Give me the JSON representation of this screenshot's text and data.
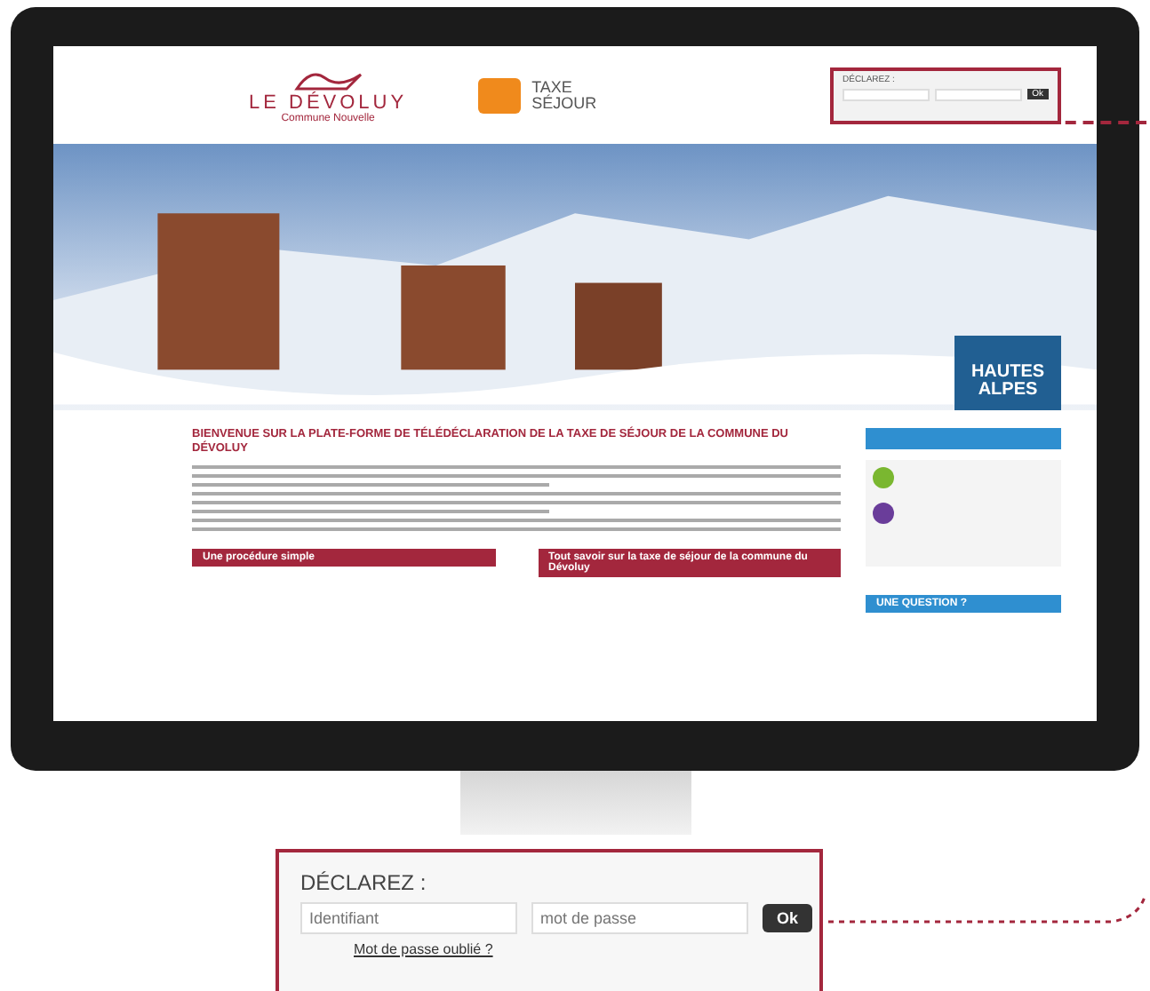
{
  "header": {
    "logo_title": "LE DÉVOLUY",
    "logo_subtitle": "Commune Nouvelle",
    "tax_logo_line1": "TAXE",
    "tax_logo_line2": "SÉJOUR",
    "login_title": "DÉCLAREZ :",
    "ok": "Ok"
  },
  "banner": {
    "badge_line1": "HAUTES",
    "badge_line2": "ALPES"
  },
  "content": {
    "heading": "BIENVENUE SUR LA PLATE-FORME DE TÉLÉDÉCLARATION DE LA TAXE DE SÉJOUR DE LA COMMUNE DU DÉVOLUY",
    "box1": "Une procédure simple",
    "box2": "Tout savoir sur la taxe de séjour de la commune du Dévoluy",
    "side_heading": "UNE QUESTION ?"
  },
  "callout": {
    "title": "DÉCLAREZ :",
    "username_placeholder": "Identifiant",
    "password_placeholder": "mot de passe",
    "ok": "Ok",
    "forgot_link": "Mot de passe oublié ?"
  }
}
